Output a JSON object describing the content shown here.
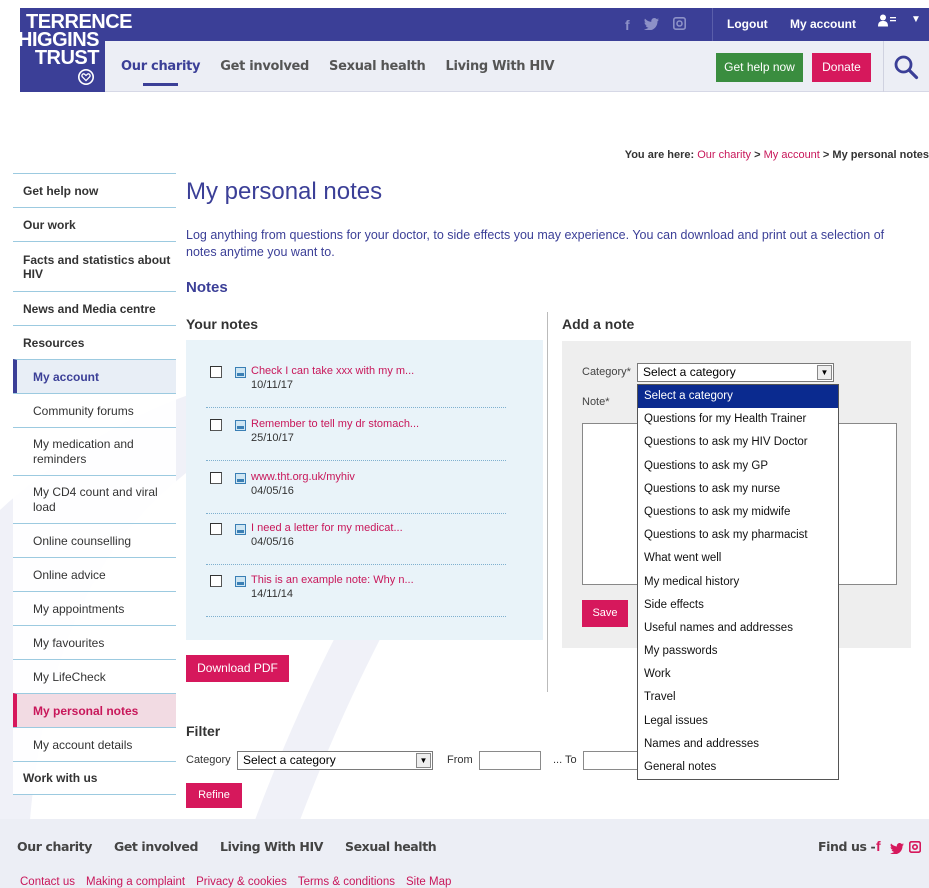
{
  "brand": {
    "logo_line1": "Terrence",
    "logo_line2": "HIGGINS",
    "logo_line3": "TRUST",
    "primary_color": "#3b3f97",
    "accent_color": "#d6185c",
    "help_color": "#3a8d3f"
  },
  "topbar": {
    "social": [
      {
        "icon": "facebook-icon",
        "glyph": "f"
      },
      {
        "icon": "twitter-icon",
        "glyph": "🐦"
      },
      {
        "icon": "instagram-icon",
        "glyph": "◘"
      }
    ],
    "logout": "Logout",
    "my_account": "My account"
  },
  "mainnav": {
    "items": [
      "Our charity",
      "Get involved",
      "Sexual health",
      "Living With HIV"
    ],
    "active": "Our charity",
    "get_help": "Get help now",
    "donate": "Donate"
  },
  "breadcrumb": {
    "prefix": "You are here:",
    "crumb1": "Our charity",
    "sep": ">",
    "crumb2": "My account",
    "current": "My personal notes"
  },
  "sidebar": {
    "items": [
      "Get help now",
      "Our work",
      "Facts and statistics about HIV",
      "News and Media centre",
      "Resources",
      "My account",
      "Community forums",
      "My medication and reminders",
      "My CD4 count and viral load",
      "Online counselling",
      "Online advice",
      "My appointments",
      "My favourites",
      "My LifeCheck",
      "My personal notes",
      "My account details",
      "Work with us"
    ]
  },
  "page": {
    "title": "My personal notes",
    "intro": "Log anything from questions for your doctor, to side effects you may experience. You can download and print out a selection of notes anytime you want to.",
    "notes_heading": "Notes",
    "your_notes_heading": "Your notes",
    "add_note_heading": "Add a note"
  },
  "notes": [
    {
      "title": "Check I can take xxx with my m...",
      "date": "10/11/17"
    },
    {
      "title": "Remember to tell my dr stomach...",
      "date": "25/10/17"
    },
    {
      "title": "www.tht.org.uk/myhiv",
      "date": "04/05/16"
    },
    {
      "title": "I need a letter for my medicat...",
      "date": "04/05/16"
    },
    {
      "title": "This is an example note: Why n...",
      "date": "14/11/14"
    }
  ],
  "download_pdf": "Download PDF",
  "add_note": {
    "category_label": "Category*",
    "category_value": "Select a category",
    "note_label": "Note*",
    "save": "Save"
  },
  "category_options": [
    "Select a category",
    "Questions for my Health Trainer",
    "Questions to ask my HIV Doctor",
    "Questions to ask my GP",
    "Questions to ask my nurse",
    "Questions to ask my midwife",
    "Questions to ask my pharmacist",
    "What went well",
    "My medical history",
    "Side effects",
    "Useful names and addresses",
    "My passwords",
    "Work",
    "Travel",
    "Legal issues",
    "Names and addresses",
    "General notes"
  ],
  "filter": {
    "heading": "Filter",
    "category_label": "Category",
    "category_value": "Select a category",
    "from_label": "From",
    "to_label": "... To",
    "refine": "Refine"
  },
  "footer": {
    "nav": [
      "Our charity",
      "Get involved",
      "Living With HIV",
      "Sexual health"
    ],
    "find_us": "Find us -",
    "links": [
      "Contact us",
      "Making a complaint",
      "Privacy & cookies",
      "Terms & conditions",
      "Site Map"
    ]
  }
}
